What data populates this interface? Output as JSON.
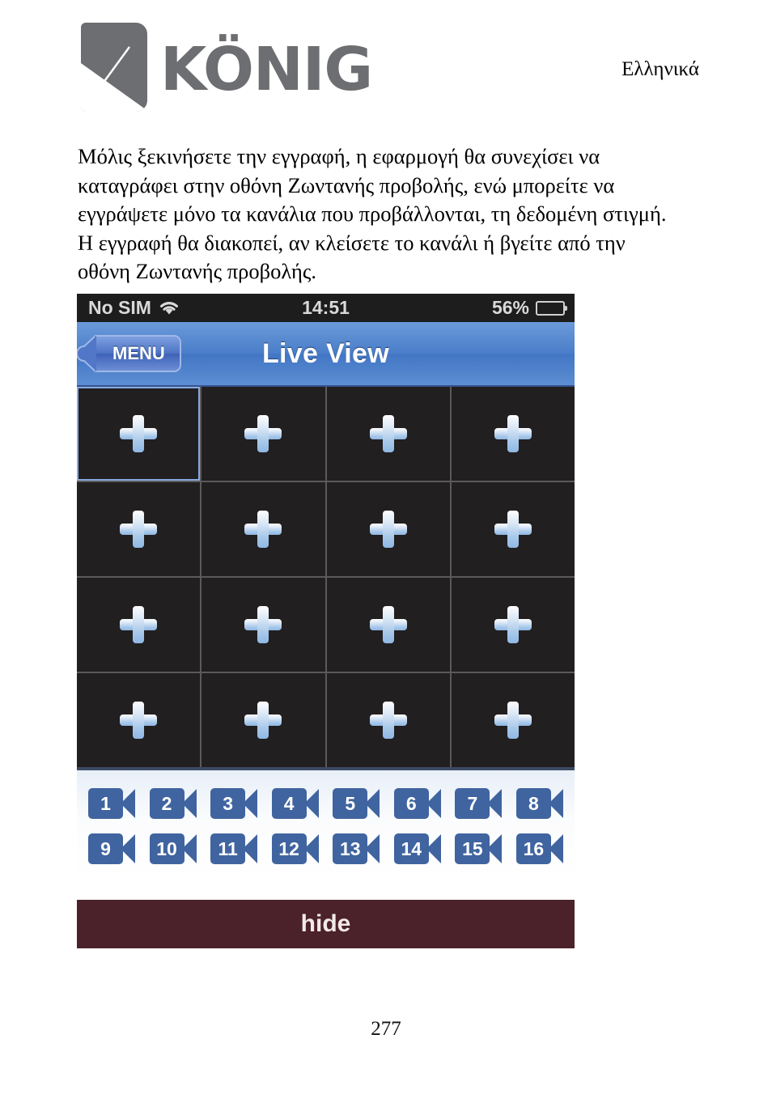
{
  "document": {
    "brand": "KÖNIG",
    "language_label": "Ελληνικά",
    "page_number": "277",
    "paragraph": "Μόλις ξεκινήσετε την εγγραφή, η εφαρμογή θα συνεχίσει να\nκαταγράφει στην οθόνη Ζωντανής προβολής, ενώ μπορείτε να\nεγγράψετε μόνο τα κανάλια που προβάλλονται, τη δεδομένη στιγμή.\nΗ εγγραφή θα διακοπεί, αν κλείσετε το κανάλι ή βγείτε από την\nοθόνη Ζωντανής προβολής."
  },
  "phone": {
    "statusbar": {
      "carrier": "No SIM",
      "wifi_icon": "wifi-icon",
      "time": "14:51",
      "battery_percent": "56%",
      "battery_icon": "battery-icon",
      "background_color": "#1d1d1d"
    },
    "navbar": {
      "back_button_label": "MENU",
      "title": "Live View",
      "accent_color": "#4a7ec9"
    },
    "grid": {
      "rows": 4,
      "columns": 4,
      "selected_cell_index": 0,
      "cell_icon": "plus-icon",
      "cell_background": "#221f20",
      "selection_color": "#88a9e0",
      "cells": [
        {
          "icon": "plus-icon"
        },
        {
          "icon": "plus-icon"
        },
        {
          "icon": "plus-icon"
        },
        {
          "icon": "plus-icon"
        },
        {
          "icon": "plus-icon"
        },
        {
          "icon": "plus-icon"
        },
        {
          "icon": "plus-icon"
        },
        {
          "icon": "plus-icon"
        },
        {
          "icon": "plus-icon"
        },
        {
          "icon": "plus-icon"
        },
        {
          "icon": "plus-icon"
        },
        {
          "icon": "plus-icon"
        },
        {
          "icon": "plus-icon"
        },
        {
          "icon": "plus-icon"
        },
        {
          "icon": "plus-icon"
        },
        {
          "icon": "plus-icon"
        }
      ]
    },
    "channel_panel": {
      "icon": "camera-icon",
      "color": "#40649f",
      "row1": [
        "1",
        "2",
        "3",
        "4",
        "5",
        "6",
        "7",
        "8"
      ],
      "row2": [
        "9",
        "10",
        "11",
        "12",
        "13",
        "14",
        "15",
        "16"
      ]
    },
    "hide_bar": {
      "label": "hide",
      "background_color": "#4b2229"
    }
  }
}
